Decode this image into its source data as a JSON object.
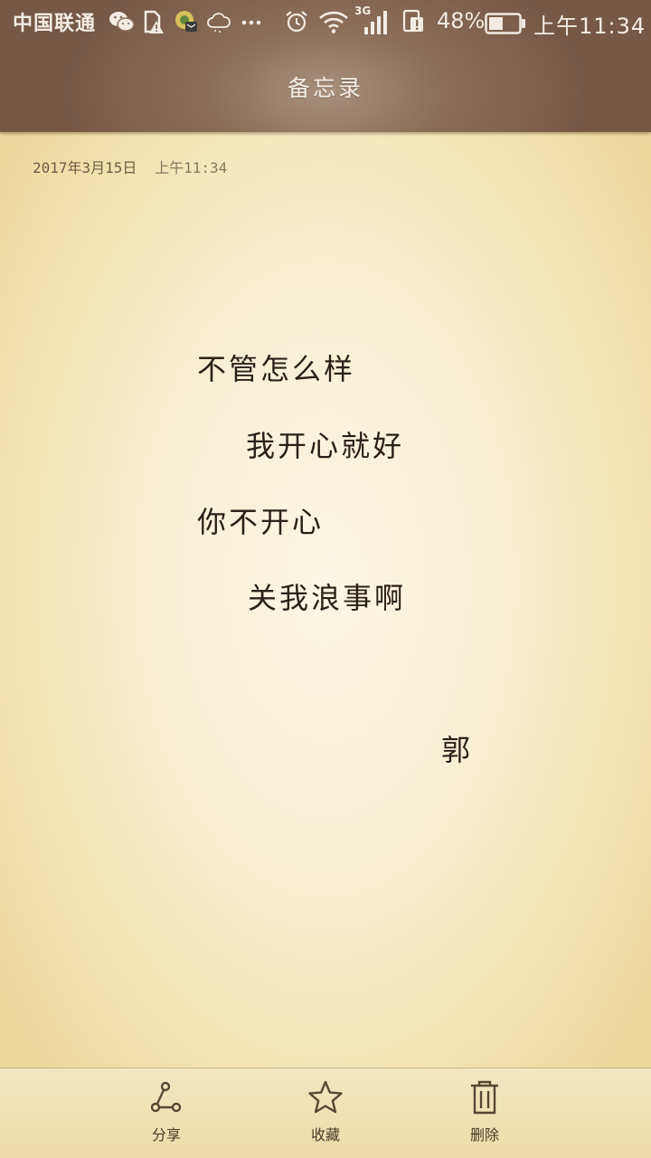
{
  "status_bar": {
    "carrier": "中国联通",
    "network_type": "3G",
    "battery_percent": "48%",
    "battery_level": 0.48,
    "time": "上午11:34",
    "icons": [
      "wechat-icon",
      "sim-warning-icon",
      "app-notification-icon",
      "cloud-icon",
      "more-dots-icon",
      "alarm-icon",
      "wifi-icon",
      "signal-icon",
      "data-alert-icon",
      "battery-icon"
    ]
  },
  "header": {
    "title": "备忘录"
  },
  "note": {
    "date": "2017年3月15日",
    "time": "上午11:34",
    "lines": [
      "不管怎么样",
      "我开心就好",
      "你不开心",
      "关我浪事啊",
      "郭"
    ]
  },
  "toolbar": {
    "share_label": "分享",
    "favorite_label": "收藏",
    "delete_label": "删除"
  },
  "colors": {
    "header": "#8c6e58",
    "paper": "#f8efd2",
    "text": "#2b2118",
    "icon": "#5a4634"
  }
}
